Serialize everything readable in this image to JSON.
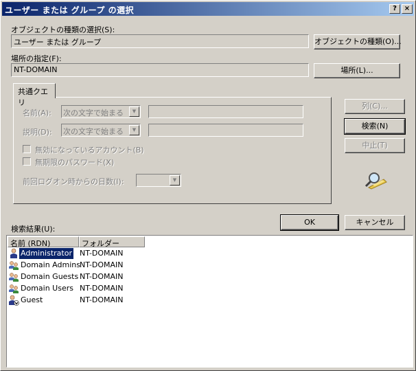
{
  "window": {
    "title": "ユーザー または グループ の選択",
    "help_button": "?",
    "close_button": "×"
  },
  "object_type": {
    "label": "オブジェクトの種類の選択(S):",
    "value": "ユーザー または グループ",
    "button": "オブジェクトの種類(O)..."
  },
  "location": {
    "label": "場所の指定(F):",
    "value": "NT-DOMAIN",
    "button": "場所(L)..."
  },
  "tab": {
    "label": "共通クエリ"
  },
  "query": {
    "name_label": "名前(A):",
    "name_combo": "次の文字で始まる",
    "desc_label": "説明(D):",
    "desc_combo": "次の文字で始まる",
    "disabled_accounts": "無効になっているアカウント(B)",
    "no_expire_password": "無期限のパスワード(X)",
    "days_since_logon": "前回ログオン時からの日数(I):"
  },
  "side_buttons": {
    "columns": "列(C)...",
    "search": "検索(N)",
    "stop": "中止(T)"
  },
  "ok": "OK",
  "cancel": "キャンセル",
  "results": {
    "label": "検索結果(U):",
    "headers": [
      "名前 (RDN)",
      "フォルダー"
    ],
    "rows": [
      {
        "name": "Administrator",
        "folder": "NT-DOMAIN",
        "icon": "user-icon"
      },
      {
        "name": "Domain Admins",
        "folder": "NT-DOMAIN",
        "icon": "group-icon"
      },
      {
        "name": "Domain Guests",
        "folder": "NT-DOMAIN",
        "icon": "group-icon"
      },
      {
        "name": "Domain Users",
        "folder": "NT-DOMAIN",
        "icon": "group-icon"
      },
      {
        "name": "Guest",
        "folder": "NT-DOMAIN",
        "icon": "disabled-user-icon"
      }
    ]
  }
}
